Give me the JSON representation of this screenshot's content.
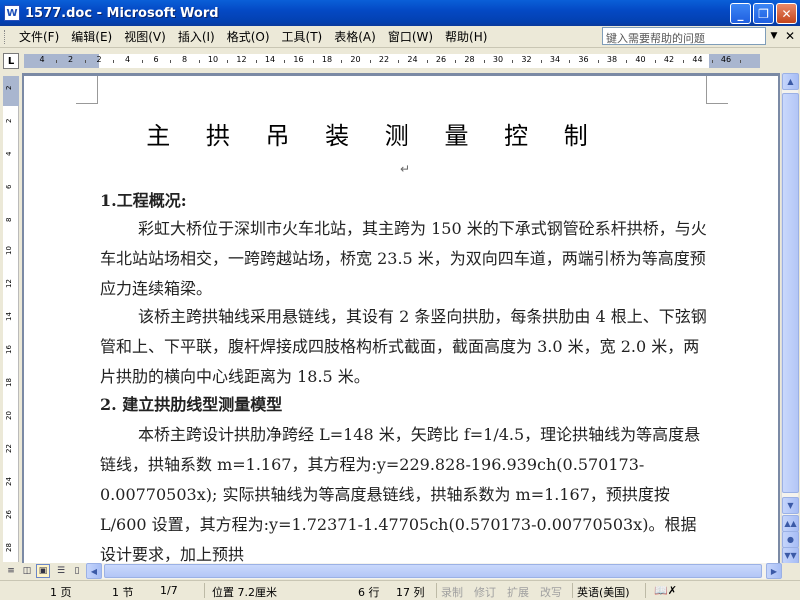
{
  "window": {
    "title": "1577.doc - Microsoft Word",
    "app_icon": "W"
  },
  "menu": {
    "items": [
      "文件(F)",
      "编辑(E)",
      "视图(V)",
      "插入(I)",
      "格式(O)",
      "工具(T)",
      "表格(A)",
      "窗口(W)",
      "帮助(H)"
    ],
    "help_placeholder": "键入需要帮助的问题"
  },
  "ruler": {
    "h_numbers": [
      "4",
      "2",
      "2",
      "4",
      "6",
      "8",
      "10",
      "12",
      "14",
      "16",
      "18",
      "20",
      "22",
      "24",
      "26",
      "28",
      "30",
      "32",
      "34",
      "36",
      "38",
      "40",
      "42",
      "44",
      "46"
    ],
    "v_numbers": [
      "2",
      "2",
      "4",
      "6",
      "8",
      "10",
      "12",
      "14",
      "16",
      "18",
      "20",
      "22",
      "24",
      "26",
      "28"
    ]
  },
  "document": {
    "title": "主 拱 吊 装 测 量 控 制",
    "sections": [
      {
        "kind": "heading",
        "text": "1.工程概况:"
      },
      {
        "kind": "body",
        "text": "彩虹大桥位于深圳市火车北站，其主跨为 150 米的下承式钢管砼系杆拱桥，与火车北站站场相交，一跨跨越站场，桥宽 23.5 米，为双向四车道，两端引桥为等高度预应力连续箱梁。"
      },
      {
        "kind": "body",
        "text": "该桥主跨拱轴线采用悬链线，其设有 2 条竖向拱肋，每条拱肋由 4 根上、下弦钢管和上、下平联，腹杆焊接成四肢格构析式截面，截面高度为 3.0 米，宽 2.0 米，两片拱肋的横向中心线距离为 18.5 米。"
      },
      {
        "kind": "heading",
        "text": "2. 建立拱肋线型测量模型"
      },
      {
        "kind": "body",
        "text": "本桥主跨设计拱肋净跨经 L=148 米，矢跨比 f=1/4.5，理论拱轴线为等高度悬链线，拱轴系数 m=1.167，其方程为:y=229.828-196.939ch(0.570173-0.00770503x); 实际拱轴线为等高度悬链线，拱轴系数为 m=1.167，预拱度按 L/600 设置，其方程为:y=1.72371-1.47705ch(0.570173-0.00770503x)。根据设计要求，加上预拱"
      }
    ]
  },
  "status": {
    "page": "1 页",
    "section": "1 节",
    "pages": "1/7",
    "position": "位置 7.2厘米",
    "line": "6 行",
    "column": "17 列",
    "rec": "录制",
    "trk": "修订",
    "ext": "扩展",
    "ovr": "改写",
    "language": "英语(美国)"
  }
}
